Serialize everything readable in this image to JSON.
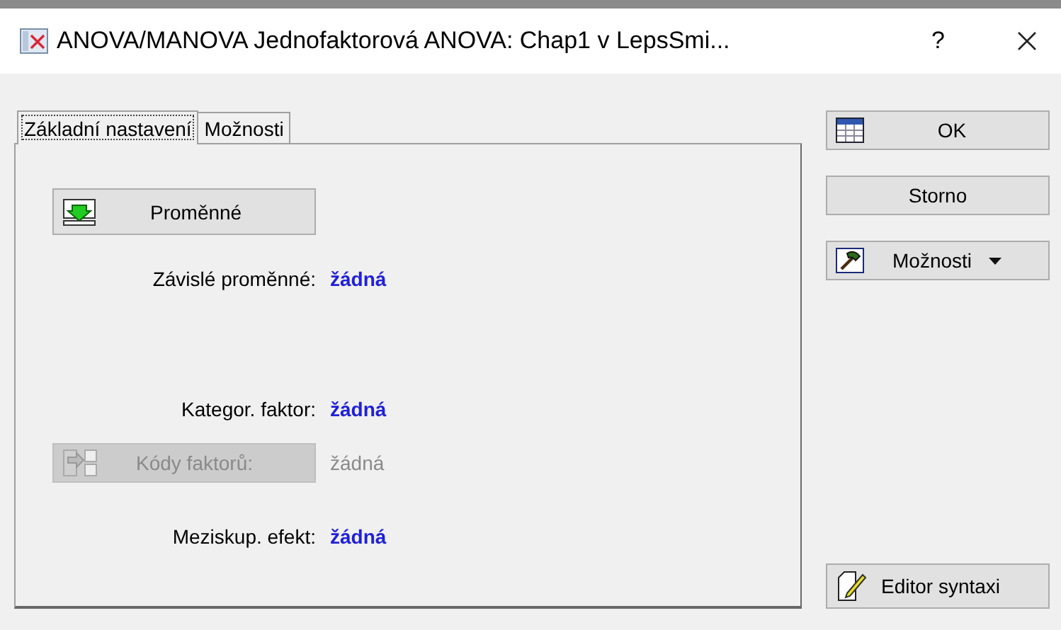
{
  "window": {
    "title": "ANOVA/MANOVA Jednofaktorová ANOVA: Chap1 v LepsSmi...",
    "help": "?"
  },
  "tabs": [
    {
      "label": "Základní nastavení",
      "selected": true
    },
    {
      "label": "Možnosti",
      "selected": false
    }
  ],
  "variables_button": {
    "label": "Proměnné"
  },
  "fields": [
    {
      "kind": "label",
      "label": "Závislé proměnné:",
      "value": "žádná",
      "disabled": false
    },
    {
      "kind": "label",
      "label": "Kategor. faktor:",
      "value": "žádná",
      "disabled": false
    },
    {
      "kind": "button",
      "label": "Kódy faktorů:",
      "value": "žádná",
      "disabled": true
    },
    {
      "kind": "label",
      "label": "Meziskup. efekt:",
      "value": "žádná",
      "disabled": false
    }
  ],
  "buttons": [
    {
      "kind": "ok",
      "label": "OK"
    },
    {
      "kind": "plain",
      "label": "Storno"
    },
    {
      "kind": "menu",
      "label": "Možnosti"
    },
    {
      "kind": "syntax",
      "label": "Editor syntaxi"
    }
  ]
}
